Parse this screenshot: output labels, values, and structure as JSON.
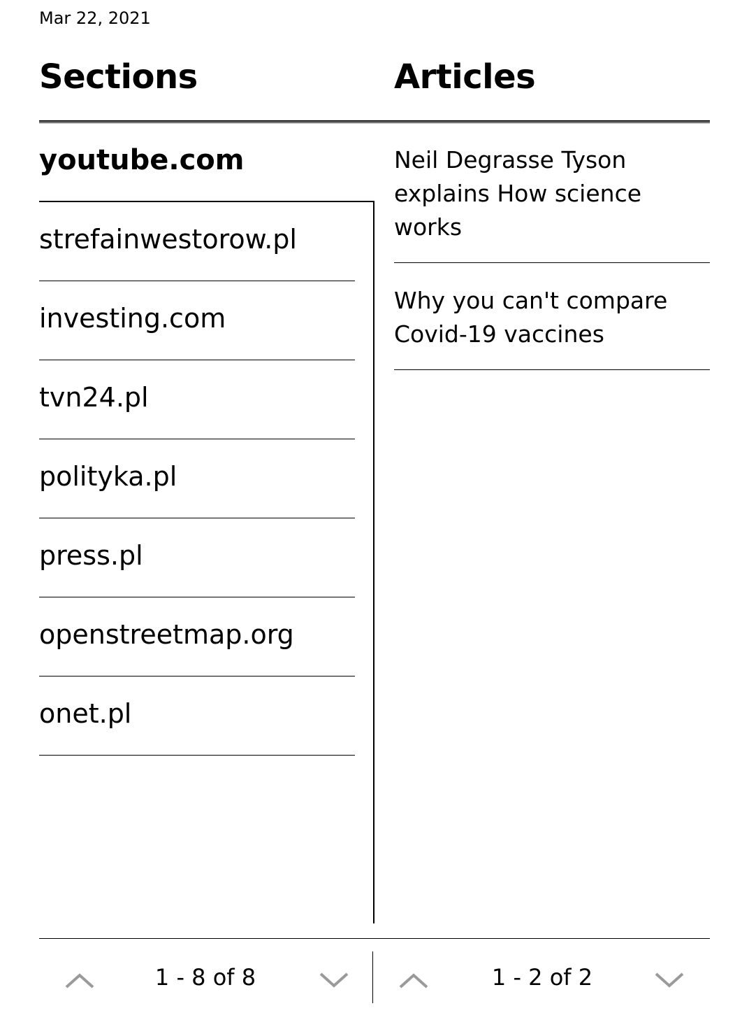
{
  "header": {
    "date": "Mar 22, 2021",
    "sections_title": "Sections",
    "articles_title": "Articles"
  },
  "sections": {
    "items": [
      {
        "label": "youtube.com",
        "selected": true
      },
      {
        "label": "strefainwestorow.pl"
      },
      {
        "label": "investing.com"
      },
      {
        "label": "tvn24.pl"
      },
      {
        "label": "polityka.pl"
      },
      {
        "label": "press.pl"
      },
      {
        "label": "openstreetmap.org"
      },
      {
        "label": "onet.pl"
      }
    ],
    "pager_label": "1 - 8 of 8"
  },
  "articles": {
    "items": [
      {
        "title": "Neil Degrasse Tyson explains How science works"
      },
      {
        "title": "Why you can't compare Covid-19 vaccines"
      }
    ],
    "pager_label": "1 - 2 of 2"
  },
  "icons": {
    "up": "chevron-up-icon",
    "down": "chevron-down-icon"
  },
  "colors": {
    "foreground": "#000000",
    "background": "#ffffff",
    "arrow": "#9a9a9a"
  }
}
